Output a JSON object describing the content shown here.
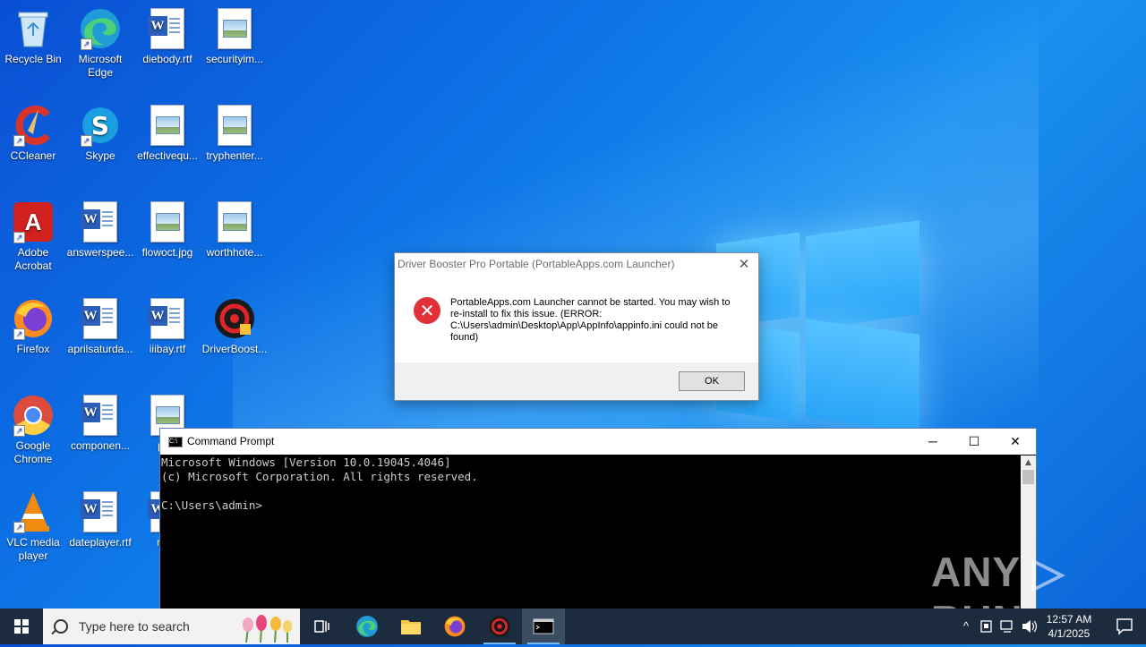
{
  "desktop": {
    "icons": [
      {
        "label": "Recycle Bin"
      },
      {
        "label": "Microsoft Edge"
      },
      {
        "label": "diebody.rtf"
      },
      {
        "label": "securityim..."
      },
      {
        "label": "CCleaner"
      },
      {
        "label": "Skype"
      },
      {
        "label": "effectivequ..."
      },
      {
        "label": "tryphenter..."
      },
      {
        "label": "Adobe Acrobat"
      },
      {
        "label": "answerspee..."
      },
      {
        "label": "flowoct.jpg"
      },
      {
        "label": "worthhote..."
      },
      {
        "label": "Firefox"
      },
      {
        "label": "aprilsaturda..."
      },
      {
        "label": "iiibay.rtf"
      },
      {
        "label": "DriverBoost..."
      },
      {
        "label": "Google Chrome"
      },
      {
        "label": "componen..."
      },
      {
        "label": "pink"
      },
      {
        "label": "VLC media player"
      },
      {
        "label": "dateplayer.rtf"
      },
      {
        "label": "read"
      }
    ]
  },
  "dialog": {
    "title": "Driver Booster Pro Portable (PortableApps.com Launcher)",
    "message": "PortableApps.com Launcher cannot be started. You may wish to re-install to fix this issue. (ERROR: C:\\Users\\admin\\Desktop\\App\\AppInfo\\appinfo.ini could not be found)",
    "ok_label": "OK",
    "close_glyph": "✕",
    "error_glyph": "✕"
  },
  "cmd": {
    "title": "Command Prompt",
    "lines": [
      "Microsoft Windows [Version 10.0.19045.4046]",
      "(c) Microsoft Corporation. All rights reserved.",
      "",
      "C:\\Users\\admin>"
    ],
    "minimize_glyph": "─",
    "maximize_glyph": "☐",
    "close_glyph": "✕"
  },
  "watermark": "ANY ▷ RUN",
  "taskbar": {
    "search_placeholder": "Type here to search",
    "clock_time": "12:57 AM",
    "clock_date": "4/1/2025",
    "tray_chevron": "^",
    "apps": [
      "task-view",
      "edge",
      "file-explorer",
      "firefox",
      "driver-booster",
      "command-prompt"
    ]
  },
  "colors": {
    "taskbar": "#1c2b3d",
    "dialog_error": "#e0303a",
    "desktop": "#0d74e6"
  }
}
